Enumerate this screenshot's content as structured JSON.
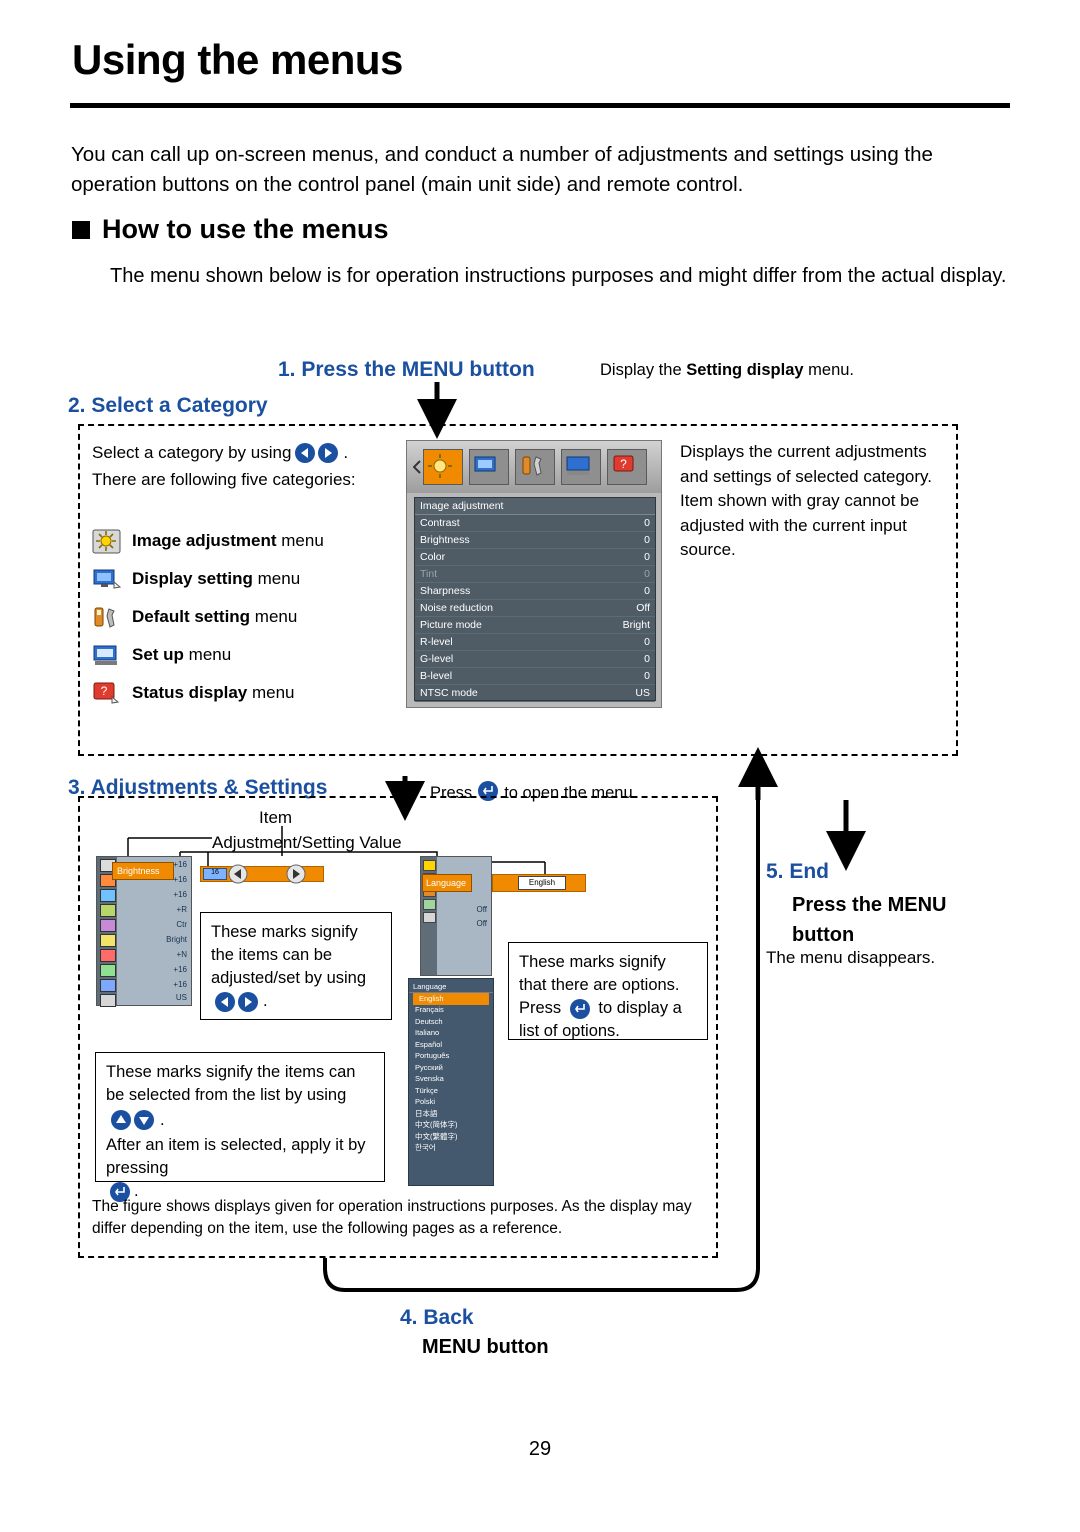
{
  "page": {
    "title": "Using the menus",
    "intro": "You can call up on-screen menus, and conduct a number of adjustments and settings using the operation buttons on the control panel (main unit side) and remote control.",
    "section_heading": "How to use the menus",
    "section_sub": "The menu shown below is for operation instructions purposes and might differ from the actual display.",
    "page_number": "29"
  },
  "steps": {
    "step1": "1. Press the MENU button",
    "step1_note_pre": "Display the ",
    "step1_note_bold": "Setting display",
    "step1_note_post": " menu.",
    "step2": "2. Select a Category",
    "step3": "3. Adjustments & Settings",
    "step3_note_pre": "Press",
    "step3_note_post": "to open the menu.",
    "step4": "4. Back",
    "step4_sub": "MENU button",
    "step5": "5. End",
    "step5_sub": "Press the MENU button",
    "step5_note": "The menu disappears."
  },
  "select_category": {
    "line1": "Select a category by using",
    "line1_end": ".",
    "line2": "There are following five categories:",
    "categories": [
      {
        "icon": "image-adjustment-icon",
        "bold": "Image adjustment",
        "rest": " menu"
      },
      {
        "icon": "display-setting-icon",
        "bold": "Display setting",
        "rest": " menu"
      },
      {
        "icon": "default-setting-icon",
        "bold": "Default setting",
        "rest": " menu"
      },
      {
        "icon": "set-up-icon",
        "bold": "Set up",
        "rest": " menu"
      },
      {
        "icon": "status-display-icon",
        "bold": "Status display",
        "rest": " menu"
      }
    ],
    "right_text": "Displays the current adjustments and settings of selected category. Item shown with gray cannot be adjusted with the current input source."
  },
  "osd": {
    "title": "Image adjustment",
    "rows": [
      {
        "label": "Contrast",
        "value": "0",
        "gray": false
      },
      {
        "label": "Brightness",
        "value": "0",
        "gray": false
      },
      {
        "label": "Color",
        "value": "0",
        "gray": false
      },
      {
        "label": "Tint",
        "value": "0",
        "gray": true
      },
      {
        "label": "Sharpness",
        "value": "0",
        "gray": false
      },
      {
        "label": "Noise reduction",
        "value": "Off",
        "gray": false
      },
      {
        "label": "Picture mode",
        "value": "Bright",
        "gray": false
      },
      {
        "label": "R-level",
        "value": "0",
        "gray": false
      },
      {
        "label": "G-level",
        "value": "0",
        "gray": false
      },
      {
        "label": "B-level",
        "value": "0",
        "gray": false
      },
      {
        "label": "NTSC mode",
        "value": "US",
        "gray": false
      }
    ]
  },
  "diagram": {
    "label_item": "Item",
    "label_adjust": "Adjustment/Setting Value",
    "callout1": "These marks signify the items can be adjusted/set by using",
    "callout1_end": ".",
    "callout2": "These marks signify that there are options. Press",
    "callout2_mid": "to display a list of options.",
    "callout3_a": "These marks signify the items can be selected from the list by using",
    "callout3_b": ".",
    "callout3_c": "After an item is selected, apply it by pressing",
    "callout3_d": ".",
    "note_bottom": "The figure shows displays given for operation instructions purposes.  As the display may differ depending on the item, use the following pages as a reference.",
    "brightness_label": "Brightness",
    "language_label": "Language",
    "english_label": "English",
    "off_label": "Off",
    "mock_values": [
      "+16",
      "+16",
      "+16",
      "+R",
      "Ctr",
      "Bright",
      "+N",
      "+16",
      "+16",
      "US"
    ],
    "lang_header": "Language",
    "lang_options": [
      "English",
      "Français",
      "Deutsch",
      "Italiano",
      "Español",
      "Português",
      "Русский",
      "Svenska",
      "Türkçe",
      "Polski",
      "日本語",
      "中文(简体字)",
      "中文(繁體字)",
      "한국어"
    ]
  },
  "colors": {
    "accent_blue": "#1b4fa0",
    "orange": "#f08a00",
    "osd_bg": "#4f5c66"
  }
}
